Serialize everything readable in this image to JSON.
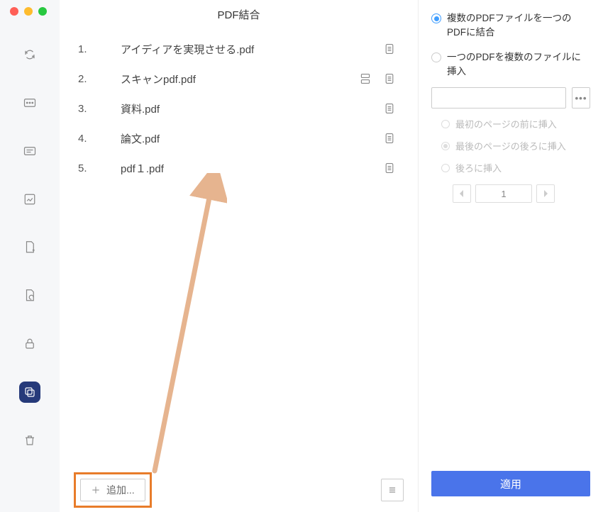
{
  "header": {
    "title": "PDF結合"
  },
  "files": [
    {
      "num": "1.",
      "name": "アイディアを実現させる.pdf",
      "split": false
    },
    {
      "num": "2.",
      "name": "スキャンpdf.pdf",
      "split": true
    },
    {
      "num": "3.",
      "name": "資料.pdf",
      "split": false
    },
    {
      "num": "4.",
      "name": "論文.pdf",
      "split": false
    },
    {
      "num": "5.",
      "name": "pdf１.pdf",
      "split": false
    }
  ],
  "footer": {
    "add_label": "追加...",
    "menu_tooltip": "メニュー"
  },
  "panel": {
    "mode_merge": "複数のPDFファイルを一つのPDFに結合",
    "mode_insert": "一つのPDFを複数のファイルに挿入",
    "path_value": "",
    "browse_label": "•••",
    "insert_before": "最初のページの前に挿入",
    "insert_after": "最後のページの後ろに挿入",
    "insert_at": "後ろに挿入",
    "page_value": "1",
    "apply_label": "適用"
  },
  "sidebar": {
    "items": [
      "refresh",
      "ocr",
      "text",
      "image",
      "page-add",
      "page-rotate",
      "lock",
      "copy",
      "trash"
    ]
  }
}
